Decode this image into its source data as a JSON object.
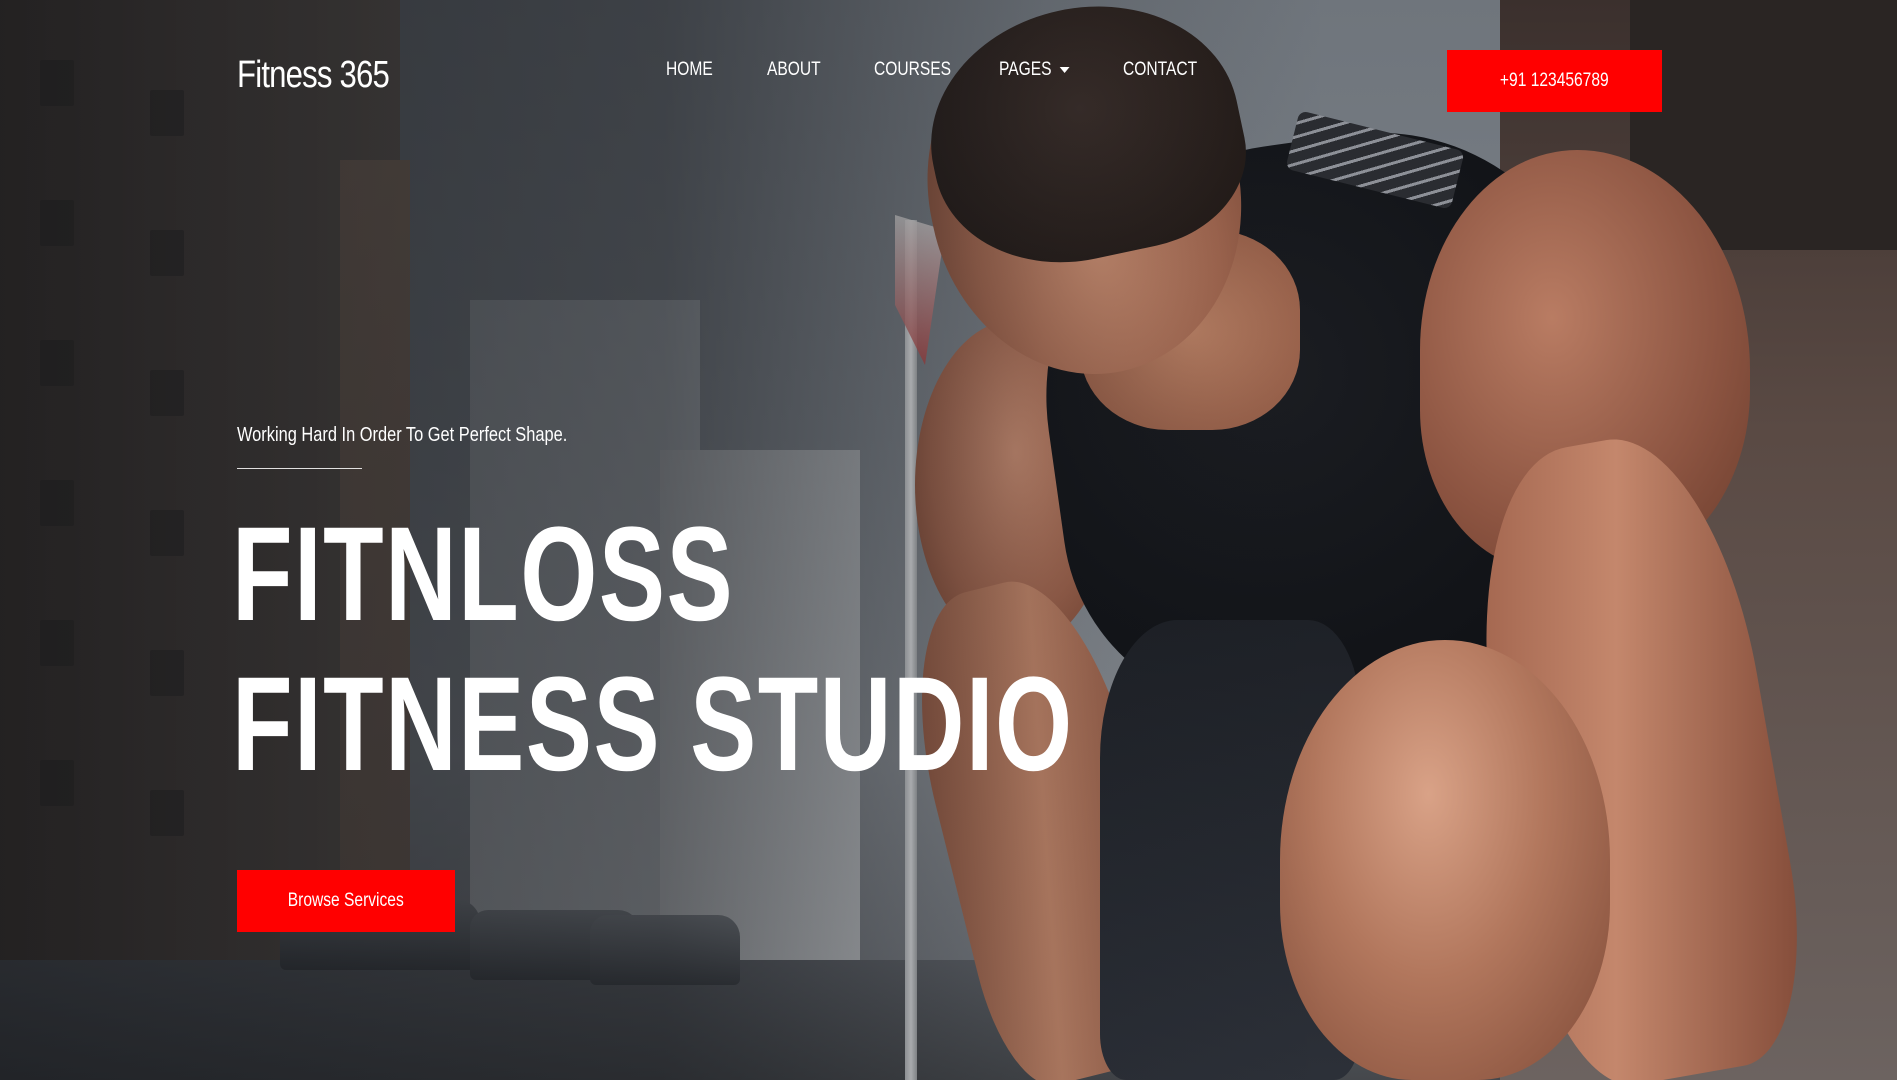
{
  "brand": {
    "name": "Fitness 365"
  },
  "nav": {
    "items": [
      {
        "label": "HOME"
      },
      {
        "label": "ABOUT"
      },
      {
        "label": "COURSES"
      },
      {
        "label": "PAGES",
        "dropdown": true
      },
      {
        "label": "CONTACT"
      }
    ]
  },
  "header": {
    "phone_label": "+91 123456789"
  },
  "hero": {
    "subtitle": "Working Hard In Order To Get Perfect Shape.",
    "title_line1": "FITNLOSS",
    "title_line2": "FITNESS STUDIO",
    "cta_label": "Browse Services"
  },
  "icons": {
    "pages_dropdown": "caret-down-icon"
  },
  "colors": {
    "accent": "#ff0000",
    "text": "#ffffff"
  }
}
